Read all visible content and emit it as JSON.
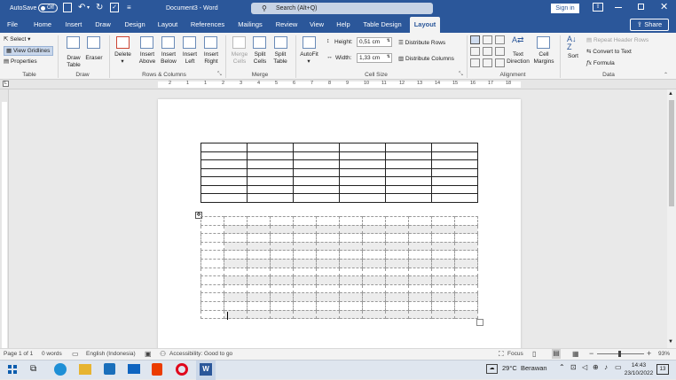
{
  "titlebar": {
    "autosave_label": "AutoSave",
    "autosave_state": "Off",
    "doc_title": "Document3 - Word",
    "search_placeholder": "Search (Alt+Q)",
    "sign_in": "Sign in",
    "share": "Share"
  },
  "menu": {
    "tabs": [
      "File",
      "Home",
      "Insert",
      "Draw",
      "Design",
      "Layout",
      "References",
      "Mailings",
      "Review",
      "View",
      "Help",
      "Table Design",
      "Layout"
    ],
    "active_index": 12
  },
  "ribbon": {
    "table_group": {
      "select": "Select",
      "view_gridlines": "View Gridlines",
      "properties": "Properties",
      "label": "Table"
    },
    "draw_group": {
      "draw_table": "Draw Table",
      "eraser": "Eraser",
      "label": "Draw"
    },
    "rows_cols_group": {
      "delete": "Delete",
      "insert_above": "Insert Above",
      "insert_below": "Insert Below",
      "insert_left": "Insert Left",
      "insert_right": "Insert Right",
      "label": "Rows & Columns"
    },
    "merge_group": {
      "merge_cells": "Merge Cells",
      "split_cells": "Split Cells",
      "split_table": "Split Table",
      "label": "Merge"
    },
    "cell_size_group": {
      "autofit": "AutoFit",
      "height_label": "Height:",
      "height_value": "0,51 cm",
      "width_label": "Width:",
      "width_value": "1,33 cm",
      "distribute_rows": "Distribute Rows",
      "distribute_columns": "Distribute Columns",
      "label": "Cell Size"
    },
    "alignment_group": {
      "text_direction": "Text Direction",
      "cell_margins": "Cell Margins",
      "label": "Alignment"
    },
    "data_group": {
      "sort": "Sort",
      "repeat_header_rows": "Repeat Header Rows",
      "convert_to_text": "Convert to Text",
      "formula": "Formula",
      "label": "Data"
    }
  },
  "ruler": {
    "marks": [
      "2",
      "1",
      "1",
      "2",
      "3",
      "4",
      "5",
      "6",
      "7",
      "8",
      "9",
      "10",
      "11",
      "12",
      "13",
      "14",
      "15",
      "16",
      "17",
      "18"
    ]
  },
  "status": {
    "page": "Page 1 of 1",
    "words": "0 words",
    "language": "English (Indonesia)",
    "accessibility": "Accessibility: Good to go",
    "focus": "Focus",
    "zoom": "93%"
  },
  "taskbar": {
    "weather_temp": "29°C",
    "weather_desc": "Berawan",
    "time": "14:43",
    "date": "23/10/2022",
    "notif_count": "13"
  },
  "colors": {
    "accent": "#2b579a",
    "ribbon_bg": "#f3f3f3",
    "share_btn": "#2b579a"
  }
}
